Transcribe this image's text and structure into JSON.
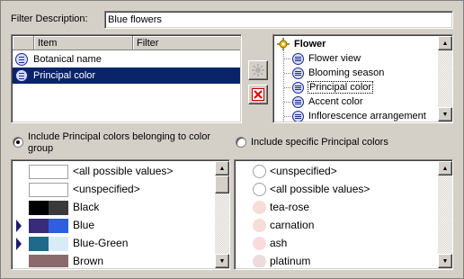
{
  "filter": {
    "label": "Filter Description:",
    "value": "Blue flowers"
  },
  "item_table": {
    "columns": [
      "Item",
      "Filter"
    ],
    "rows": [
      {
        "item": "Botanical name",
        "filter": "",
        "selected": false
      },
      {
        "item": "Principal color",
        "filter": "",
        "selected": true
      }
    ]
  },
  "side_buttons": {
    "add": "add-icon",
    "remove": "remove-icon"
  },
  "tree": {
    "root": "Flower",
    "root_icon": "gear-icon",
    "children": [
      "Flower view",
      "Blooming season",
      "Principal color",
      "Accent color",
      "Inflorescence arrangement"
    ],
    "focused_child": "Principal color"
  },
  "radios": {
    "group_label": "Include Principal colors belonging to color group",
    "group_selected": true,
    "specific_label": "Include specific Principal colors",
    "specific_selected": false
  },
  "color_groups": [
    {
      "label": "<all possible values>",
      "colors": [],
      "marked": false
    },
    {
      "label": "<unspecified>",
      "colors": [],
      "marked": false
    },
    {
      "label": "Black",
      "colors": [
        "#000000",
        "#3a3a3a"
      ],
      "marked": false
    },
    {
      "label": "Blue",
      "colors": [
        "#3a2a7a",
        "#2f5fe0"
      ],
      "marked": true
    },
    {
      "label": "Blue-Green",
      "colors": [
        "#1f6a8a",
        "#d8ecf8"
      ],
      "marked": true
    },
    {
      "label": "Brown",
      "colors": [
        "#8a6a6a",
        "#8a6a6a"
      ],
      "marked": false
    }
  ],
  "specific_colors": [
    {
      "label": "<unspecified>",
      "color": "#ffffff",
      "outlined": true
    },
    {
      "label": "<all possible values>",
      "color": "#ffffff",
      "outlined": true
    },
    {
      "label": "tea-rose",
      "color": "#f8dcd8",
      "outlined": false
    },
    {
      "label": "carnation",
      "color": "#f8dcd8",
      "outlined": false
    },
    {
      "label": "ash",
      "color": "#f8dcdc",
      "outlined": false
    },
    {
      "label": "platinum",
      "color": "#ecdcdc",
      "outlined": false
    }
  ],
  "colors": {
    "selection": "#0a246a",
    "face": "#d4d0c8"
  }
}
